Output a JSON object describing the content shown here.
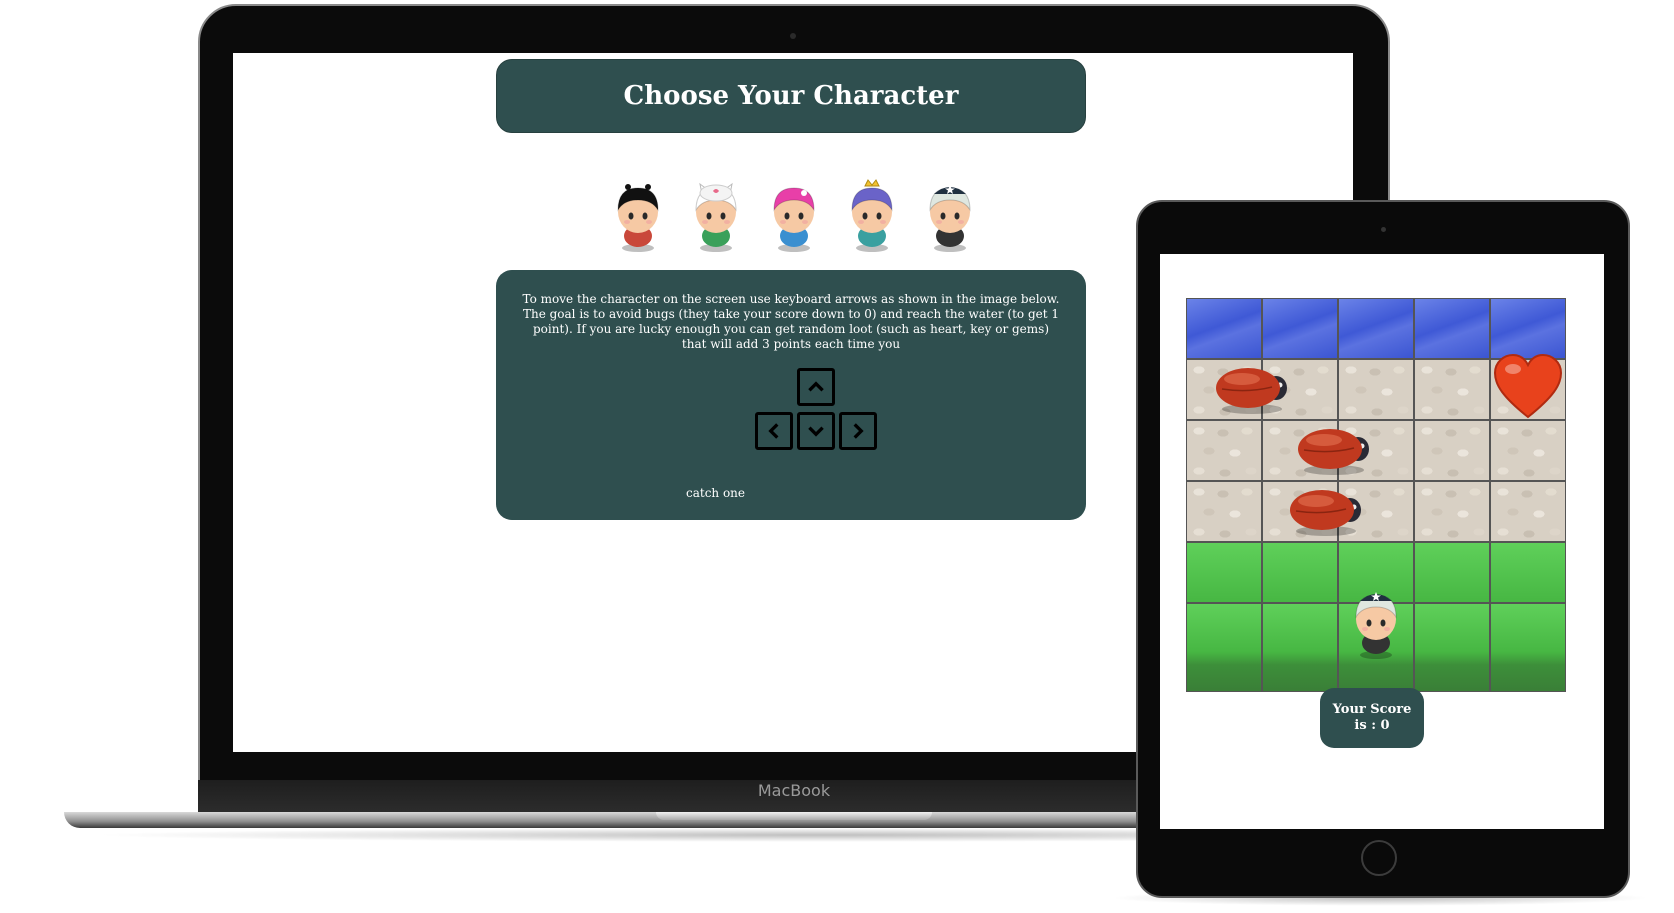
{
  "macbook": {
    "brand_label": "MacBook",
    "page": {
      "title": "Choose Your Character",
      "characters": [
        {
          "name": "boy",
          "icon": "boy-character-icon",
          "hair": "#111111",
          "shirt": "#c9483a"
        },
        {
          "name": "cat-girl",
          "icon": "cat-girl-character-icon",
          "hair": "#ffffff",
          "shirt": "#3aa05a"
        },
        {
          "name": "pink-girl",
          "icon": "pink-hair-girl-character-icon",
          "hair": "#e83fa8",
          "shirt": "#3a8fd0"
        },
        {
          "name": "princess",
          "icon": "princess-character-icon",
          "hair": "#6a63c8",
          "shirt": "#3aa0a0"
        },
        {
          "name": "horn-girl",
          "icon": "horn-girl-character-icon",
          "hair": "#dfe7e0",
          "shirt": "#333333"
        }
      ],
      "instructions": "To move the character on the screen use keyboard arrows as shown in the image below. The goal is to avoid bugs (they take your score down to 0) and reach the water (to get 1 point). If you are lucky enough you can get random loot (such as heart, key or gems) that will add 3 points each time you",
      "keys": [
        "up",
        "left",
        "down",
        "right"
      ],
      "catch_text": "catch one"
    }
  },
  "ipad": {
    "game": {
      "rows": [
        "water",
        "stone",
        "stone",
        "stone",
        "grass",
        "grass"
      ],
      "columns": 5,
      "entities": [
        {
          "type": "bug",
          "row": 1,
          "col": 0
        },
        {
          "type": "bug",
          "row": 2,
          "col": 1
        },
        {
          "type": "bug",
          "row": 3,
          "col": 1
        },
        {
          "type": "heart",
          "row": 1,
          "col": 4
        },
        {
          "type": "player",
          "row": 5,
          "col": 2
        }
      ],
      "score_label": "Your Score is : 0"
    }
  },
  "colors": {
    "panel": "#2f4f4f",
    "water": "#4a62dc",
    "grass": "#52c44d",
    "bug": "#c0391f",
    "heart": "#e8421c"
  }
}
